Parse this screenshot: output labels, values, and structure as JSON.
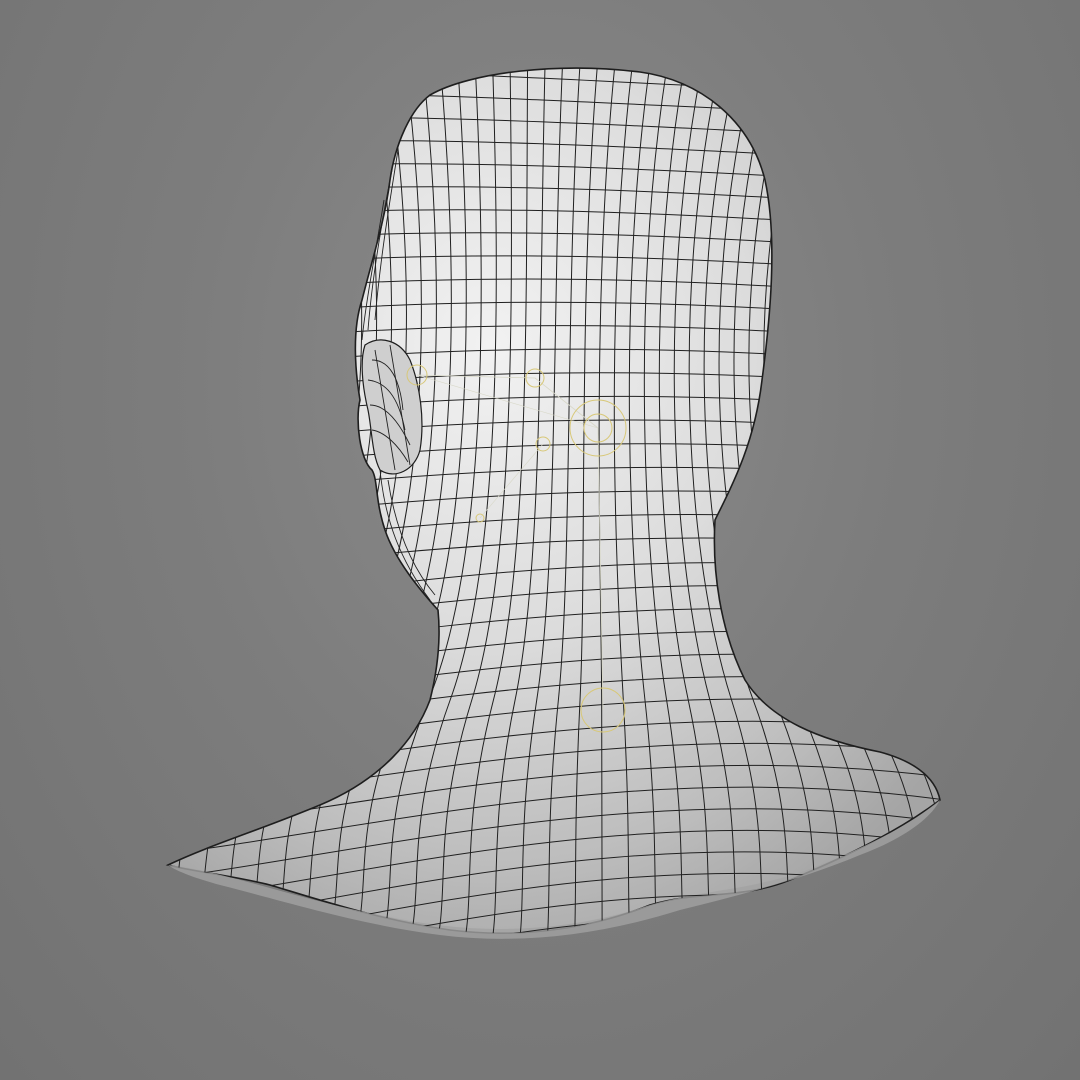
{
  "viewport": {
    "background_color": "#7a7a7a",
    "mesh_color": "#d9d9d9",
    "wire_color": "#1e1e1e",
    "joint_color": "#d8c878"
  },
  "model": {
    "name": "head-bust-wireframe",
    "joints": [
      {
        "name": "ear-joint"
      },
      {
        "name": "jaw-joint"
      },
      {
        "name": "head-joint"
      },
      {
        "name": "head-end-joint"
      },
      {
        "name": "chin-joint"
      },
      {
        "name": "neck-joint"
      }
    ]
  }
}
